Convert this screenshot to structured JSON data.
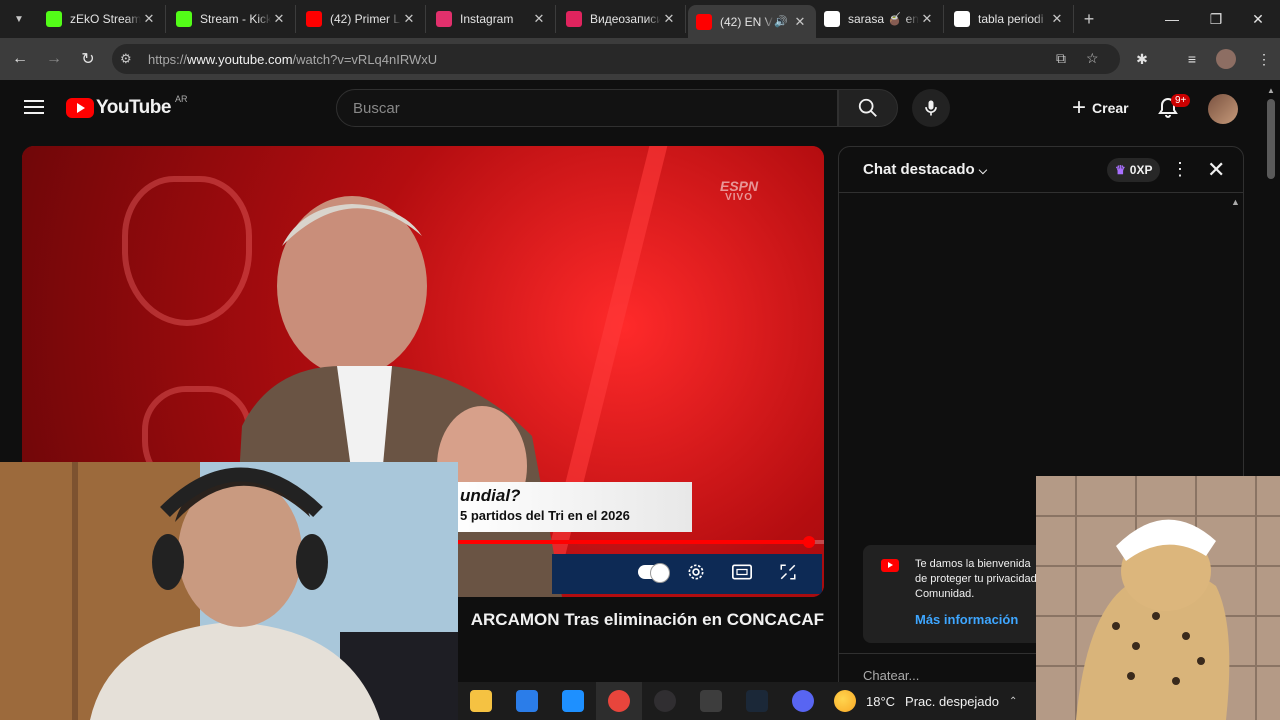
{
  "browser": {
    "tabs": [
      {
        "title": "zEkO Stream",
        "favicon": "kick-icon",
        "color": "#53fc18"
      },
      {
        "title": "Stream - Kick",
        "favicon": "kick-icon",
        "color": "#53fc18"
      },
      {
        "title": "(42) Primer L",
        "favicon": "youtube-icon",
        "color": "#ff0000"
      },
      {
        "title": "Instagram",
        "favicon": "instagram-icon",
        "color": "#e1306c"
      },
      {
        "title": "Видеозаписи",
        "favicon": "vk-video-icon",
        "color": "#e0245e"
      },
      {
        "title": "(42) EN V",
        "favicon": "youtube-icon",
        "color": "#ff0000",
        "active": true
      },
      {
        "title": "sarasa 🧉 en",
        "favicon": "x-icon",
        "color": "#ffffff"
      },
      {
        "title": "tabla periodi",
        "favicon": "google-icon",
        "color": "#ffffff"
      }
    ],
    "url_prefix": "https://",
    "url_host": "www.youtube.com",
    "url_rest": "/watch?v=vRLq4nIRWxU"
  },
  "youtube": {
    "logo_text": "YouTube",
    "country_code": "AR",
    "search_placeholder": "Buscar",
    "create_label": "Crear",
    "notif_badge": "9+"
  },
  "video": {
    "watermark_brand": "ESPN",
    "watermark_sub": "VIVO",
    "lower_third_question": "undial?",
    "lower_third_sub": "5 partidos del Tri en el 2026",
    "progress": 0.96,
    "title": "ARCAMON Tras eliminación en CONCACAF"
  },
  "chat": {
    "header_title": "Chat destacado",
    "xp_label": "0XP",
    "welcome_line1": "Te damos la bienvenida",
    "welcome_line2": "de proteger tu privacidad",
    "welcome_line3": "Comunidad.",
    "more_info": "Más información",
    "input_placeholder": "Chatear..."
  },
  "taskbar": {
    "apps": [
      "file-explorer-icon",
      "ms-store-icon",
      "outlook-icon",
      "chrome-icon",
      "obs-icon",
      "app-icon",
      "steam-icon",
      "discord-icon"
    ],
    "temperature": "18°C",
    "weather_desc": "Prac. despejado"
  }
}
